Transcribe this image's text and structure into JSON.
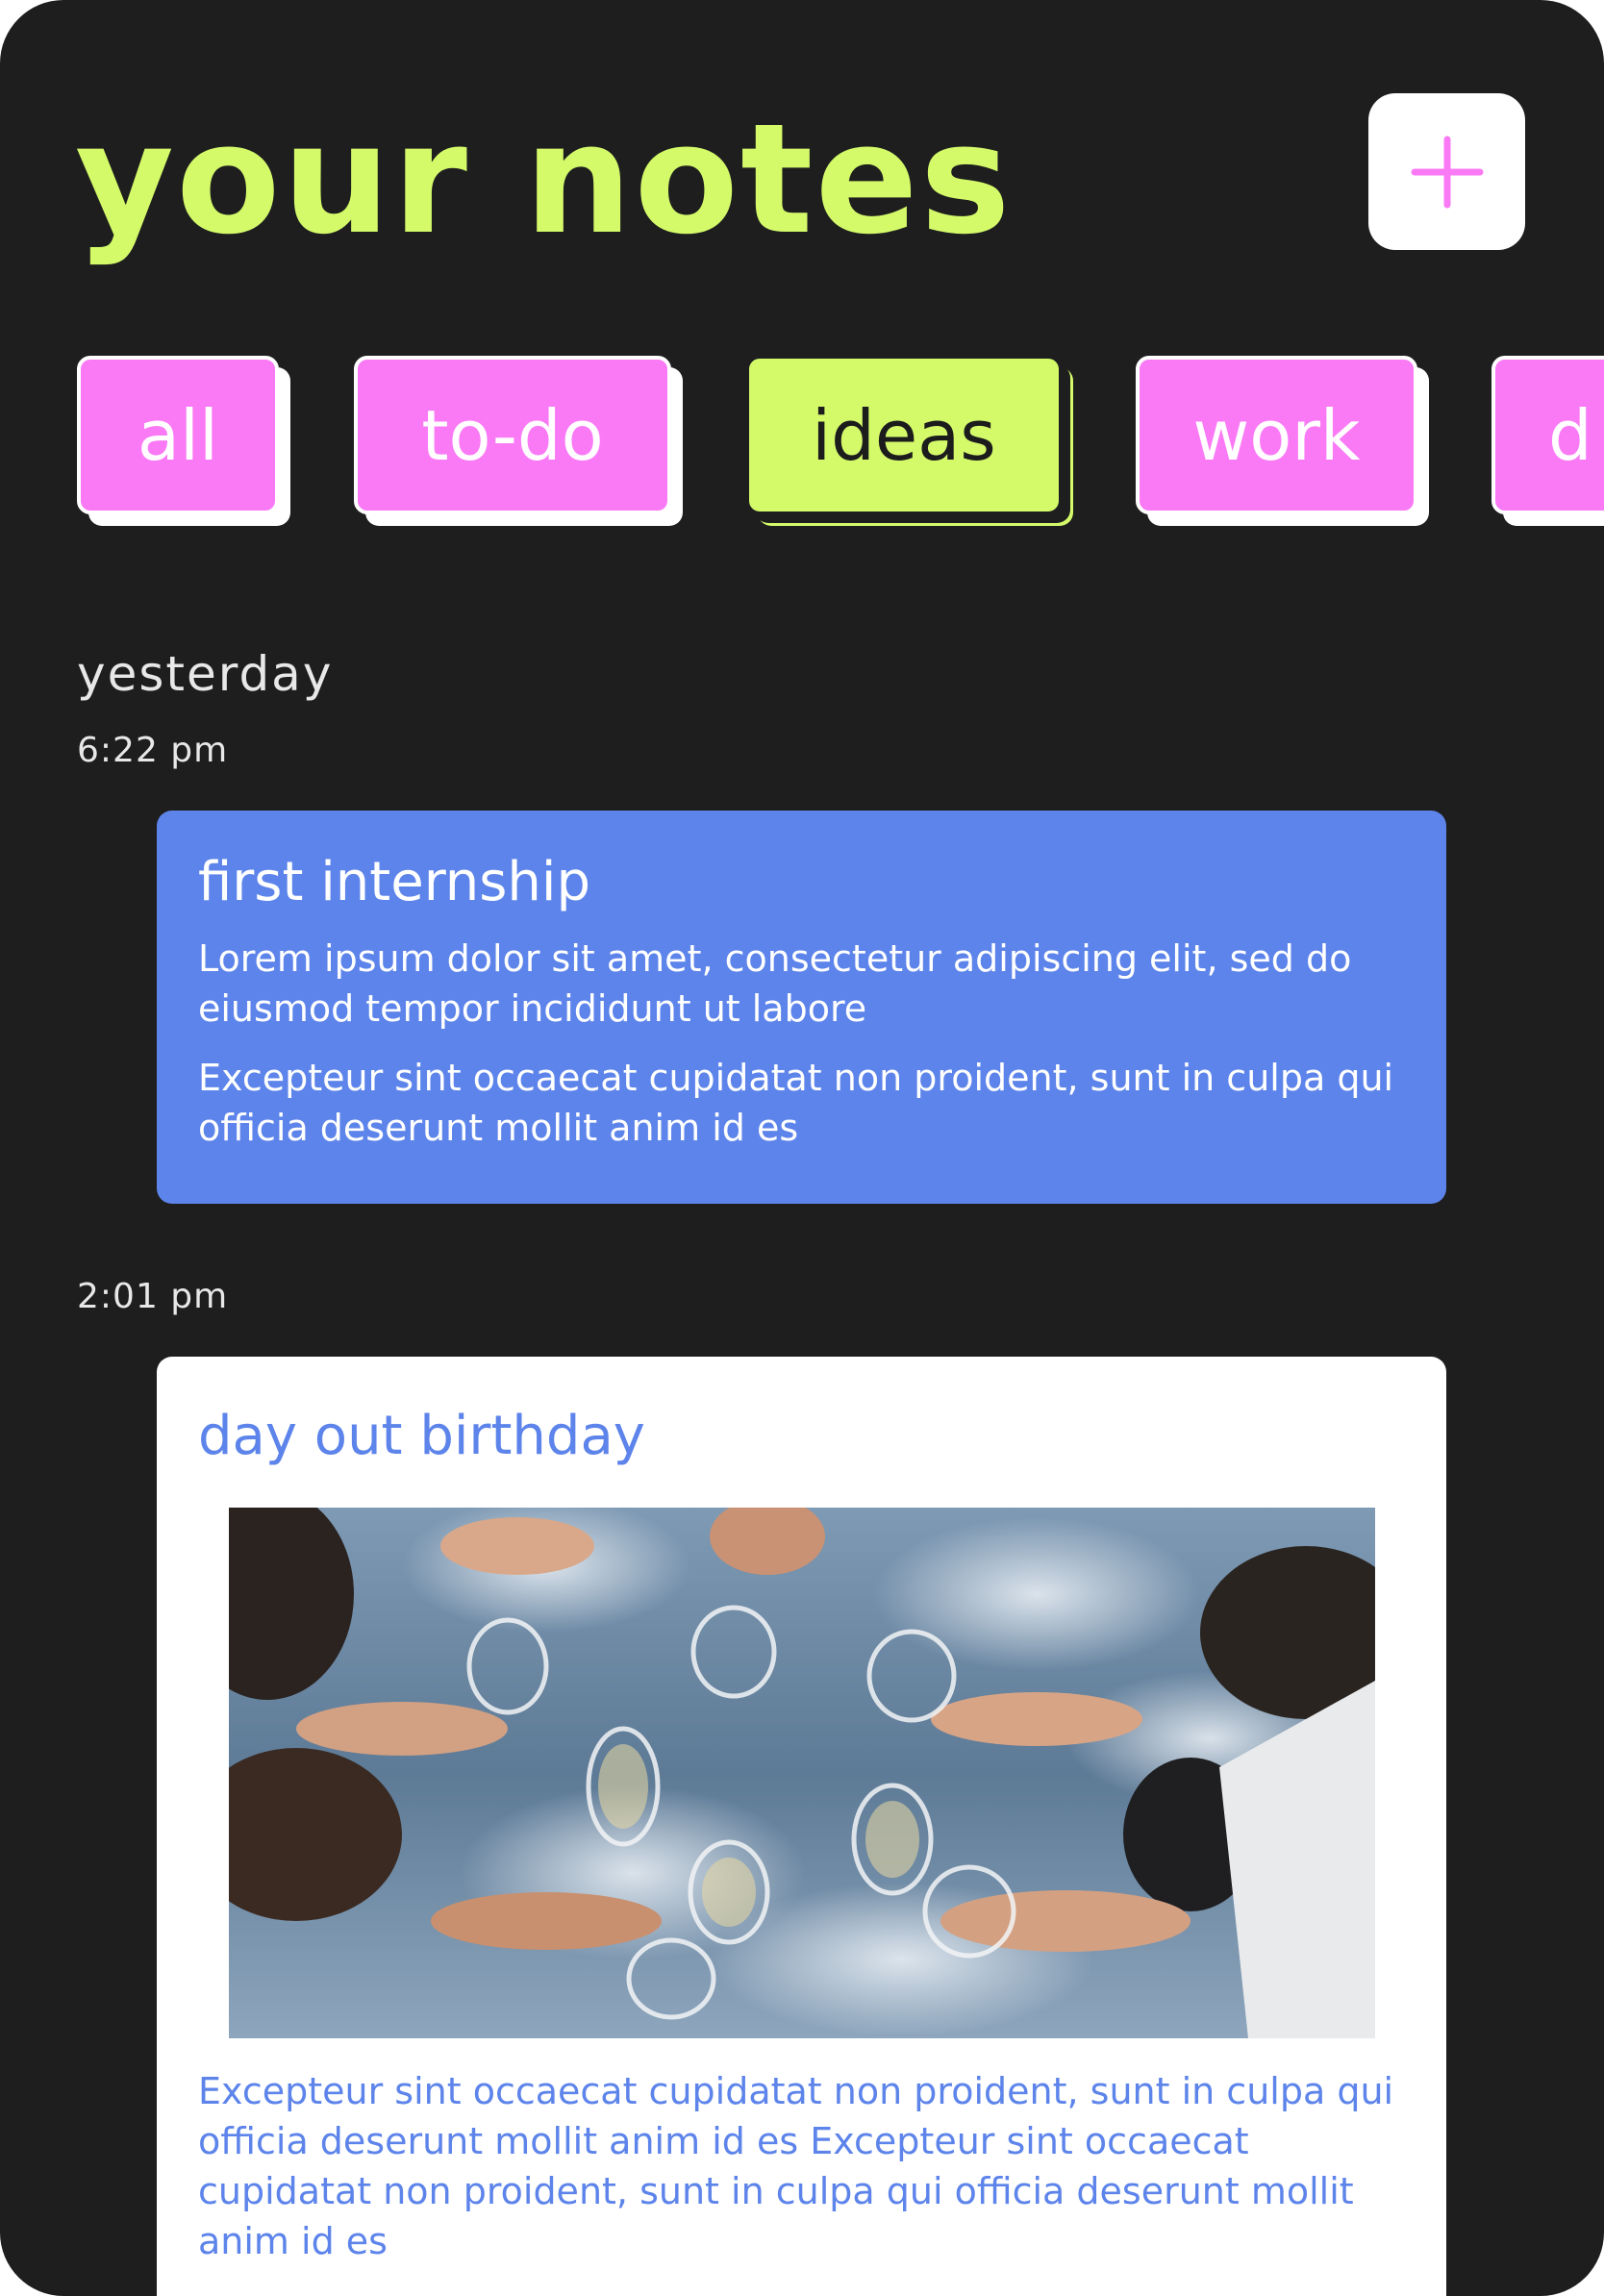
{
  "header": {
    "title": "your notes",
    "add_button_icon": "plus-icon",
    "add_icon_color": "#fa7af6"
  },
  "filters": [
    {
      "label": "all",
      "active": false
    },
    {
      "label": "to-do",
      "active": false
    },
    {
      "label": "ideas",
      "active": true
    },
    {
      "label": "work",
      "active": false
    },
    {
      "label": "d",
      "active": false
    }
  ],
  "groups": {
    "day_label": "yesterday",
    "time_1": "6:22 pm",
    "time_2": "2:01 pm"
  },
  "notes": [
    {
      "title": "first internship",
      "paragraphs": [
        "Lorem ipsum dolor sit amet, consectetur adipiscing elit, sed do eiusmod tempor incididunt ut labore",
        "Excepteur sint occaecat cupidatat non proident, sunt in culpa qui officia deserunt mollit anim id es"
      ],
      "color": "#5d84ea"
    },
    {
      "title": "day out birthday",
      "image": "celebration-toast-photo",
      "paragraph": "Excepteur sint occaecat cupidatat non proident, sunt in culpa qui officia deserunt mollit anim id es Excepteur sint occaecat cupidatat non proident, sunt in culpa qui officia deserunt mollit anim id es",
      "color": "#ffffff"
    }
  ],
  "colors": {
    "background": "#1e1e1e",
    "accent_lime": "#d4fa6a",
    "accent_pink": "#fa7af6",
    "accent_blue": "#5d84ea"
  }
}
